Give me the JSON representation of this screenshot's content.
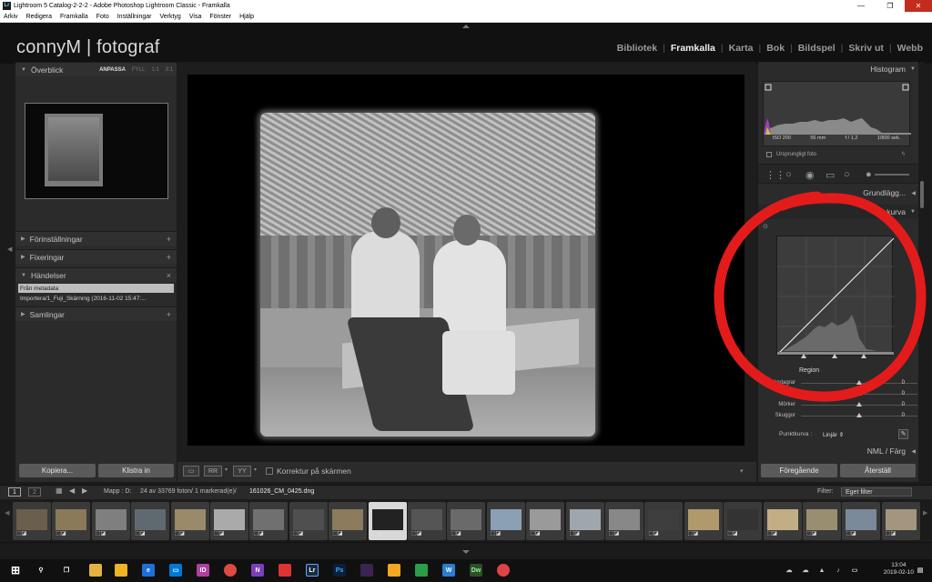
{
  "window": {
    "title": "Lightroom 5 Catalog-2-2-2 - Adobe Photoshop Lightroom Classic - Framkalla",
    "app_icon_text": "Lr"
  },
  "menu": [
    "Arkiv",
    "Redigera",
    "Framkalla",
    "Foto",
    "Inställningar",
    "Verktyg",
    "Visa",
    "Fönster",
    "Hjälp"
  ],
  "identity": {
    "logo": "connyM | fotograf"
  },
  "modules": [
    {
      "label": "Bibliotek",
      "active": false
    },
    {
      "label": "Framkalla",
      "active": true
    },
    {
      "label": "Karta",
      "active": false
    },
    {
      "label": "Bok",
      "active": false
    },
    {
      "label": "Bildspel",
      "active": false
    },
    {
      "label": "Skriv ut",
      "active": false
    },
    {
      "label": "Webb",
      "active": false
    }
  ],
  "left": {
    "navigator": {
      "title": "Överblick",
      "zoom": [
        "ANPASSA",
        "FYLL",
        "1:1",
        "3:1"
      ]
    },
    "presets": "Förinställningar",
    "snapshots": "Fixeringar",
    "history": {
      "title": "Händelser",
      "items": [
        "Från metadata",
        "Importera/1_Fuji_Skärning (2016-11-02 15:47:..."
      ]
    },
    "collections": "Samlingar",
    "copy_button": "Kopiera...",
    "paste_button": "Klistra in"
  },
  "toolbar": {
    "softproof_label": "Korrektur på skärmen"
  },
  "right": {
    "histogram": {
      "title": "Histogram",
      "iso": "ISO 200",
      "focal": "56 mm",
      "aperture": "f / 1,2",
      "shutter": "1/800 sek."
    },
    "original_photo": "Ursprungligt foto",
    "basic": "Grundlägg...",
    "tone_curve": {
      "title": "Tonkurva",
      "region_label": "Region",
      "sliders": [
        {
          "label": "Högdagrar",
          "value": "0",
          "pos": 0.5
        },
        {
          "label": "Ljus",
          "value": "0",
          "pos": 0.5
        },
        {
          "label": "Mörker",
          "value": "0",
          "pos": 0.5
        },
        {
          "label": "Skuggor",
          "value": "0",
          "pos": 0.5
        }
      ],
      "point_curve_label": "Punktkurva :",
      "point_curve_value": "Linjär"
    },
    "hsl": "NML / Färg",
    "previous_button": "Föregående",
    "reset_button": "Återställ"
  },
  "filmbar": {
    "page1": "1",
    "page2": "2",
    "path": "Mapp : D:",
    "count": "24 av 33769 foton/ 1 markerad(e)/",
    "filename": "161026_CM_0425.dng",
    "filter_label": "Filter:",
    "filter_value": "Eget filter"
  },
  "filmstrip": {
    "count": 23,
    "selected_index": 9
  },
  "tray": {
    "time": "13:04",
    "date": "2019-02-10"
  },
  "colors": {
    "accent_red": "#e41b1b",
    "panel": "#2b2b2b"
  }
}
